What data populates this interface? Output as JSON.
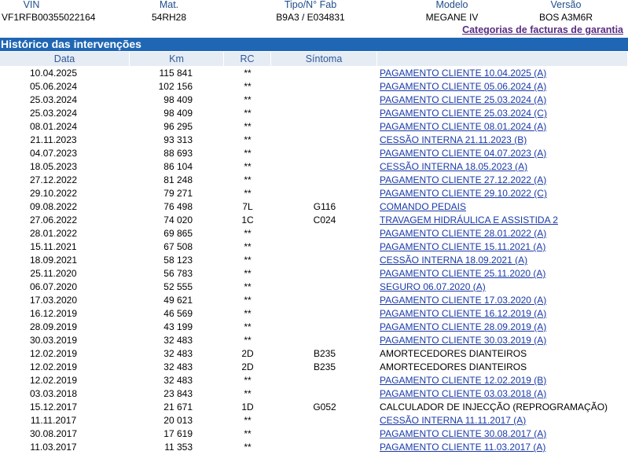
{
  "vehicle": {
    "headers": [
      "VIN",
      "Mat.",
      "Tipo/N° Fab",
      "Modelo",
      "Versão"
    ],
    "values": [
      "VF1RFB00355022164",
      "54RH28",
      "B9A3 / E034831",
      "MEGANE IV",
      "BOS A3M6R"
    ]
  },
  "categories_link": "Categorias de facturas de garantia",
  "section_title": "Histórico das intervenções",
  "table": {
    "headers": [
      "Data",
      "Km",
      "RC",
      "Síntoma",
      ""
    ],
    "rows": [
      {
        "date": "10.04.2025",
        "km": "115 841",
        "rc": "**",
        "symptom": "",
        "desc": "PAGAMENTO CLIENTE 10.04.2025 (A)",
        "link": true
      },
      {
        "date": "05.06.2024",
        "km": "102 156",
        "rc": "**",
        "symptom": "",
        "desc": "PAGAMENTO CLIENTE 05.06.2024 (A)",
        "link": true
      },
      {
        "date": "25.03.2024",
        "km": "98 409",
        "rc": "**",
        "symptom": "",
        "desc": "PAGAMENTO CLIENTE 25.03.2024 (A)",
        "link": true
      },
      {
        "date": "25.03.2024",
        "km": "98 409",
        "rc": "**",
        "symptom": "",
        "desc": "PAGAMENTO CLIENTE 25.03.2024 (C)",
        "link": true
      },
      {
        "date": "08.01.2024",
        "km": "96 295",
        "rc": "**",
        "symptom": "",
        "desc": "PAGAMENTO CLIENTE 08.01.2024 (A)",
        "link": true
      },
      {
        "date": "21.11.2023",
        "km": "93 313",
        "rc": "**",
        "symptom": "",
        "desc": "CESSÃO INTERNA 21.11.2023 (B)",
        "link": true
      },
      {
        "date": "04.07.2023",
        "km": "88 693",
        "rc": "**",
        "symptom": "",
        "desc": "PAGAMENTO CLIENTE 04.07.2023 (A)",
        "link": true
      },
      {
        "date": "18.05.2023",
        "km": "86 104",
        "rc": "**",
        "symptom": "",
        "desc": "CESSÃO INTERNA 18.05.2023 (A)",
        "link": true
      },
      {
        "date": "27.12.2022",
        "km": "81 248",
        "rc": "**",
        "symptom": "",
        "desc": "PAGAMENTO CLIENTE 27.12.2022 (A)",
        "link": true
      },
      {
        "date": "29.10.2022",
        "km": "79 271",
        "rc": "**",
        "symptom": "",
        "desc": "PAGAMENTO CLIENTE 29.10.2022 (C)",
        "link": true
      },
      {
        "date": "09.08.2022",
        "km": "76 498",
        "rc": "7L",
        "symptom": "G116",
        "desc": "COMANDO PEDAIS",
        "link": true
      },
      {
        "date": "27.06.2022",
        "km": "74 020",
        "rc": "1C",
        "symptom": "C024",
        "desc": "TRAVAGEM HIDRÁULICA E ASSISTIDA 2",
        "link": true
      },
      {
        "date": "28.01.2022",
        "km": "69 865",
        "rc": "**",
        "symptom": "",
        "desc": "PAGAMENTO CLIENTE 28.01.2022 (A)",
        "link": true
      },
      {
        "date": "15.11.2021",
        "km": "67 508",
        "rc": "**",
        "symptom": "",
        "desc": "PAGAMENTO CLIENTE 15.11.2021 (A)",
        "link": true
      },
      {
        "date": "18.09.2021",
        "km": "58 123",
        "rc": "**",
        "symptom": "",
        "desc": "CESSÃO INTERNA 18.09.2021 (A)",
        "link": true
      },
      {
        "date": "25.11.2020",
        "km": "56 783",
        "rc": "**",
        "symptom": "",
        "desc": "PAGAMENTO CLIENTE 25.11.2020 (A)",
        "link": true
      },
      {
        "date": "06.07.2020",
        "km": "52 555",
        "rc": "**",
        "symptom": "",
        "desc": "SEGURO 06.07.2020 (A)",
        "link": true
      },
      {
        "date": "17.03.2020",
        "km": "49 621",
        "rc": "**",
        "symptom": "",
        "desc": "PAGAMENTO CLIENTE 17.03.2020 (A)",
        "link": true
      },
      {
        "date": "16.12.2019",
        "km": "46 569",
        "rc": "**",
        "symptom": "",
        "desc": "PAGAMENTO CLIENTE 16.12.2019 (A)",
        "link": true
      },
      {
        "date": "28.09.2019",
        "km": "43 199",
        "rc": "**",
        "symptom": "",
        "desc": "PAGAMENTO CLIENTE 28.09.2019 (A)",
        "link": true
      },
      {
        "date": "30.03.2019",
        "km": "32 483",
        "rc": "**",
        "symptom": "",
        "desc": "PAGAMENTO CLIENTE 30.03.2019 (A)",
        "link": true
      },
      {
        "date": "12.02.2019",
        "km": "32 483",
        "rc": "2D",
        "symptom": "B235",
        "desc": "AMORTECEDORES DIANTEIROS",
        "link": false
      },
      {
        "date": "12.02.2019",
        "km": "32 483",
        "rc": "2D",
        "symptom": "B235",
        "desc": "AMORTECEDORES DIANTEIROS",
        "link": false
      },
      {
        "date": "12.02.2019",
        "km": "32 483",
        "rc": "**",
        "symptom": "",
        "desc": "PAGAMENTO CLIENTE 12.02.2019 (B)",
        "link": true
      },
      {
        "date": "03.03.2018",
        "km": "23 843",
        "rc": "**",
        "symptom": "",
        "desc": "PAGAMENTO CLIENTE 03.03.2018 (A)",
        "link": true
      },
      {
        "date": "15.12.2017",
        "km": "21 671",
        "rc": "1D",
        "symptom": "G052",
        "desc": "CALCULADOR DE INJECÇÃO (REPROGRAMAÇÃO)",
        "link": false
      },
      {
        "date": "11.11.2017",
        "km": "20 013",
        "rc": "**",
        "symptom": "",
        "desc": "CESSÃO INTERNA 11.11.2017 (A)",
        "link": true
      },
      {
        "date": "30.08.2017",
        "km": "17 619",
        "rc": "**",
        "symptom": "",
        "desc": "PAGAMENTO CLIENTE 30.08.2017 (A)",
        "link": true
      },
      {
        "date": "11.03.2017",
        "km": "11 353",
        "rc": "**",
        "symptom": "",
        "desc": "PAGAMENTO CLIENTE 11.03.2017 (A)",
        "link": true
      }
    ]
  }
}
